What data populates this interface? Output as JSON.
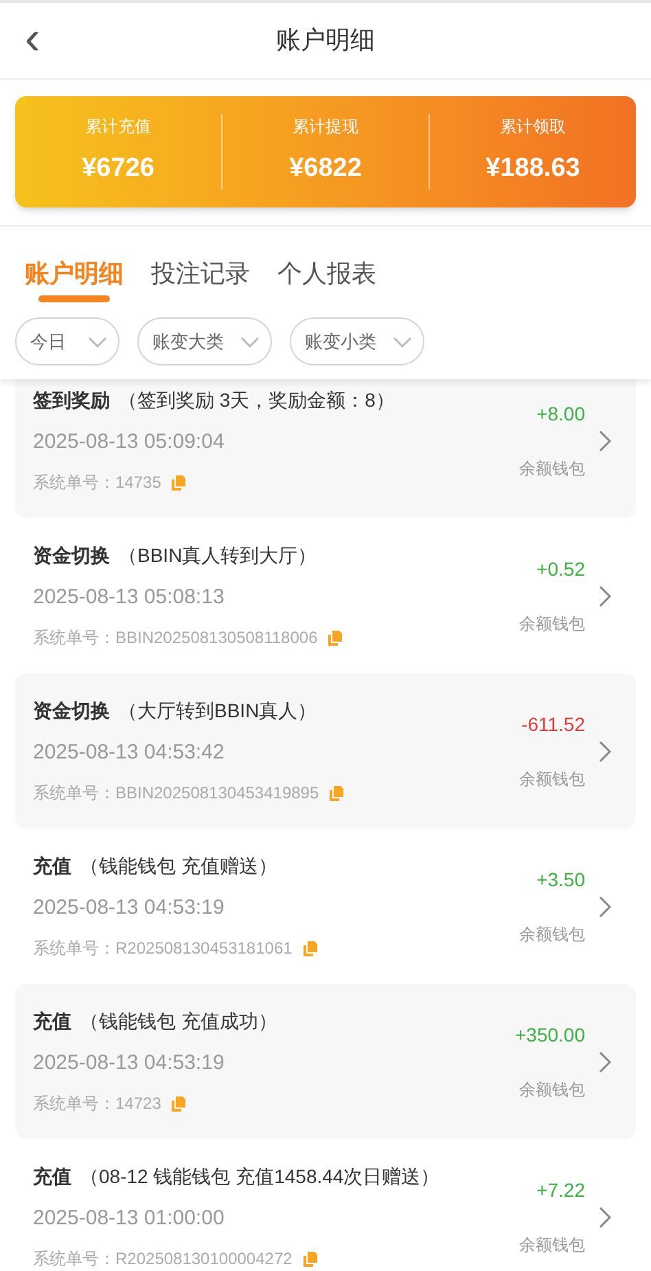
{
  "header": {
    "back": "‹",
    "title": "账户明细"
  },
  "summary": [
    {
      "label": "累计充值",
      "value": "¥6726"
    },
    {
      "label": "累计提现",
      "value": "¥6822"
    },
    {
      "label": "累计领取",
      "value": "¥188.63"
    }
  ],
  "tabs": [
    {
      "label": "账户明细",
      "selected": true
    },
    {
      "label": "投注记录",
      "selected": false
    },
    {
      "label": "个人报表",
      "selected": false
    }
  ],
  "filters": [
    {
      "label": "今日"
    },
    {
      "label": "账变大类"
    },
    {
      "label": "账变小类"
    }
  ],
  "records": [
    {
      "type": "签到奖励",
      "detail": "（签到奖励 3天，奖励金额：8）",
      "time": "2025-08-13 05:09:04",
      "order_label": "系统单号：",
      "order_no": "14735",
      "amount": "+8.00",
      "color": "#3cb043",
      "wallet": "余额钱包"
    },
    {
      "type": "资金切换",
      "detail": "（BBIN真人转到大厅）",
      "time": "2025-08-13 05:08:13",
      "order_label": "系统单号：",
      "order_no": "BBIN202508130508118006",
      "amount": "+0.52",
      "color": "#3cb043",
      "wallet": "余额钱包"
    },
    {
      "type": "资金切换",
      "detail": "（大厅转到BBIN真人）",
      "time": "2025-08-13 04:53:42",
      "order_label": "系统单号：",
      "order_no": "BBIN202508130453419895",
      "amount": "-611.52",
      "color": "#e03c3c",
      "wallet": "余额钱包"
    },
    {
      "type": "充值",
      "detail": "（钱能钱包 充值赠送）",
      "time": "2025-08-13 04:53:19",
      "order_label": "系统单号：",
      "order_no": "R202508130453181061",
      "amount": "+3.50",
      "color": "#3cb043",
      "wallet": "余额钱包"
    },
    {
      "type": "充值",
      "detail": "（钱能钱包 充值成功）",
      "time": "2025-08-13 04:53:19",
      "order_label": "系统单号：",
      "order_no": "14723",
      "amount": "+350.00",
      "color": "#3cb043",
      "wallet": "余额钱包"
    },
    {
      "type": "充值",
      "detail": "（08-12 钱能钱包 充值1458.44次日赠送）",
      "time": "2025-08-13 01:00:00",
      "order_label": "系统单号：",
      "order_no": "R202508130100004272",
      "amount": "+7.22",
      "color": "#3cb043",
      "wallet": "余额钱包"
    }
  ]
}
